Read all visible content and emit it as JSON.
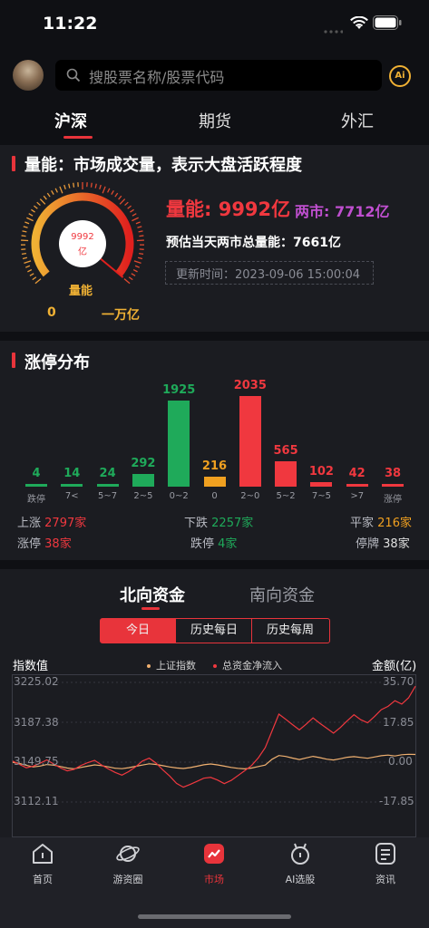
{
  "status_bar": {
    "time": "11:22"
  },
  "header": {
    "search_placeholder": "搜股票名称/股票代码",
    "ai_label": "Ai"
  },
  "top_tabs": [
    {
      "label": "沪深",
      "active": true
    },
    {
      "label": "期货",
      "active": false
    },
    {
      "label": "外汇",
      "active": false
    }
  ],
  "energy": {
    "title": "量能：市场成交量，表示大盘活跃程度",
    "main": "量能: 9992亿",
    "market": "两市: 7712亿",
    "estimate": "预估当天两市总量能：7661亿",
    "update": "更新时间：2023-09-06 15:00:04",
    "gauge_value_num": "9992",
    "gauge_value_unit": "亿",
    "gauge_label": "量能",
    "gauge_min": "0",
    "gauge_max": "一万亿",
    "gauge_fraction": 0.9992
  },
  "limit": {
    "title": "涨停分布",
    "stats": {
      "up_label": "上涨",
      "up_value": "2797家",
      "down_label": "下跌",
      "down_value": "2257家",
      "flat_label": "平家",
      "flat_value": "216家",
      "limitup_label": "涨停",
      "limitup_value": "38家",
      "limitdown_label": "跌停",
      "limitdown_value": "4家",
      "halt_label": "停牌",
      "halt_value": "38家"
    }
  },
  "chart_data": [
    {
      "type": "bar",
      "categories": [
        "跌停",
        "7<",
        "5~7",
        "2~5",
        "0~2",
        "0",
        "2~0",
        "5~2",
        "7~5",
        ">7",
        "涨停"
      ],
      "values": [
        4,
        14,
        24,
        292,
        1925,
        216,
        2035,
        565,
        102,
        42,
        38
      ],
      "colors": [
        "#1faa5a",
        "#1faa5a",
        "#1faa5a",
        "#1faa5a",
        "#1faa5a",
        "#f0a020",
        "#f0383f",
        "#f0383f",
        "#f0383f",
        "#f0383f",
        "#f0383f"
      ]
    },
    {
      "type": "line",
      "y_left_label": "指数值",
      "y_right_label": "金额(亿)",
      "y_left_ticks": [
        "3225.02",
        "3187.38",
        "3149.75",
        "3112.11"
      ],
      "y_right_ticks": [
        "35.70",
        "17.85",
        "0.00",
        "-17.85"
      ],
      "ylim_left": [
        3112.11,
        3225.02
      ],
      "ylim_right": [
        -17.85,
        35.7
      ],
      "series": [
        {
          "name": "上证指数",
          "color": "#f0b070",
          "values": [
            3149.7,
            3148.5,
            3146.8,
            3145.2,
            3146.1,
            3147.5,
            3146.9,
            3145.6,
            3144.2,
            3143.5,
            3144.8,
            3146.0,
            3147.2,
            3146.5,
            3145.3,
            3144.0,
            3143.6,
            3144.5,
            3145.8,
            3147.0,
            3148.2,
            3147.6,
            3146.4,
            3145.2,
            3144.3,
            3143.8,
            3144.6,
            3145.9,
            3147.3,
            3148.0,
            3147.2,
            3146.0,
            3144.8,
            3143.9,
            3143.4,
            3144.2,
            3145.6,
            3147.0,
            3152.5,
            3156.0,
            3155.1,
            3153.6,
            3152.2,
            3153.8,
            3155.2,
            3154.0,
            3152.6,
            3151.8,
            3153.0,
            3154.4,
            3155.0,
            3154.2,
            3153.4,
            3154.6,
            3155.8,
            3156.4,
            3155.6,
            3156.8,
            3157.2,
            3157.0
          ]
        },
        {
          "name": "总资金净流入",
          "color": "#f0383f",
          "values": [
            0.5,
            -1.0,
            -2.5,
            -1.8,
            -0.5,
            1.0,
            -0.8,
            -2.6,
            -3.9,
            -3.2,
            -1.5,
            -0.2,
            0.8,
            -1.2,
            -3.0,
            -4.6,
            -5.8,
            -4.2,
            -2.1,
            0.5,
            1.8,
            -0.4,
            -3.5,
            -6.2,
            -9.5,
            -11.2,
            -10.0,
            -8.6,
            -7.2,
            -6.8,
            -8.0,
            -9.6,
            -8.2,
            -6.0,
            -3.8,
            -1.5,
            2.0,
            6.5,
            14.0,
            21.5,
            19.2,
            16.8,
            14.5,
            17.0,
            19.8,
            17.4,
            15.2,
            13.0,
            15.5,
            18.5,
            21.2,
            19.0,
            17.6,
            20.4,
            23.5,
            25.0,
            27.5,
            26.0,
            28.8,
            34.0
          ]
        }
      ]
    }
  ],
  "flow": {
    "tabs": [
      "北向资金",
      "南向资金"
    ],
    "segments": [
      "今日",
      "历史每日",
      "历史每周"
    ]
  },
  "tabbar": [
    {
      "label": "首页",
      "icon": "home-icon",
      "active": false
    },
    {
      "label": "游资圈",
      "icon": "planet-icon",
      "active": false
    },
    {
      "label": "市场",
      "icon": "market-chart-icon",
      "active": true
    },
    {
      "label": "AI选股",
      "icon": "robot-icon",
      "active": false
    },
    {
      "label": "资讯",
      "icon": "news-icon",
      "active": false
    }
  ],
  "colors": {
    "accent": "#e8343b",
    "rise": "#f0383f",
    "fall": "#1faa5a",
    "flat": "#f0a020"
  }
}
